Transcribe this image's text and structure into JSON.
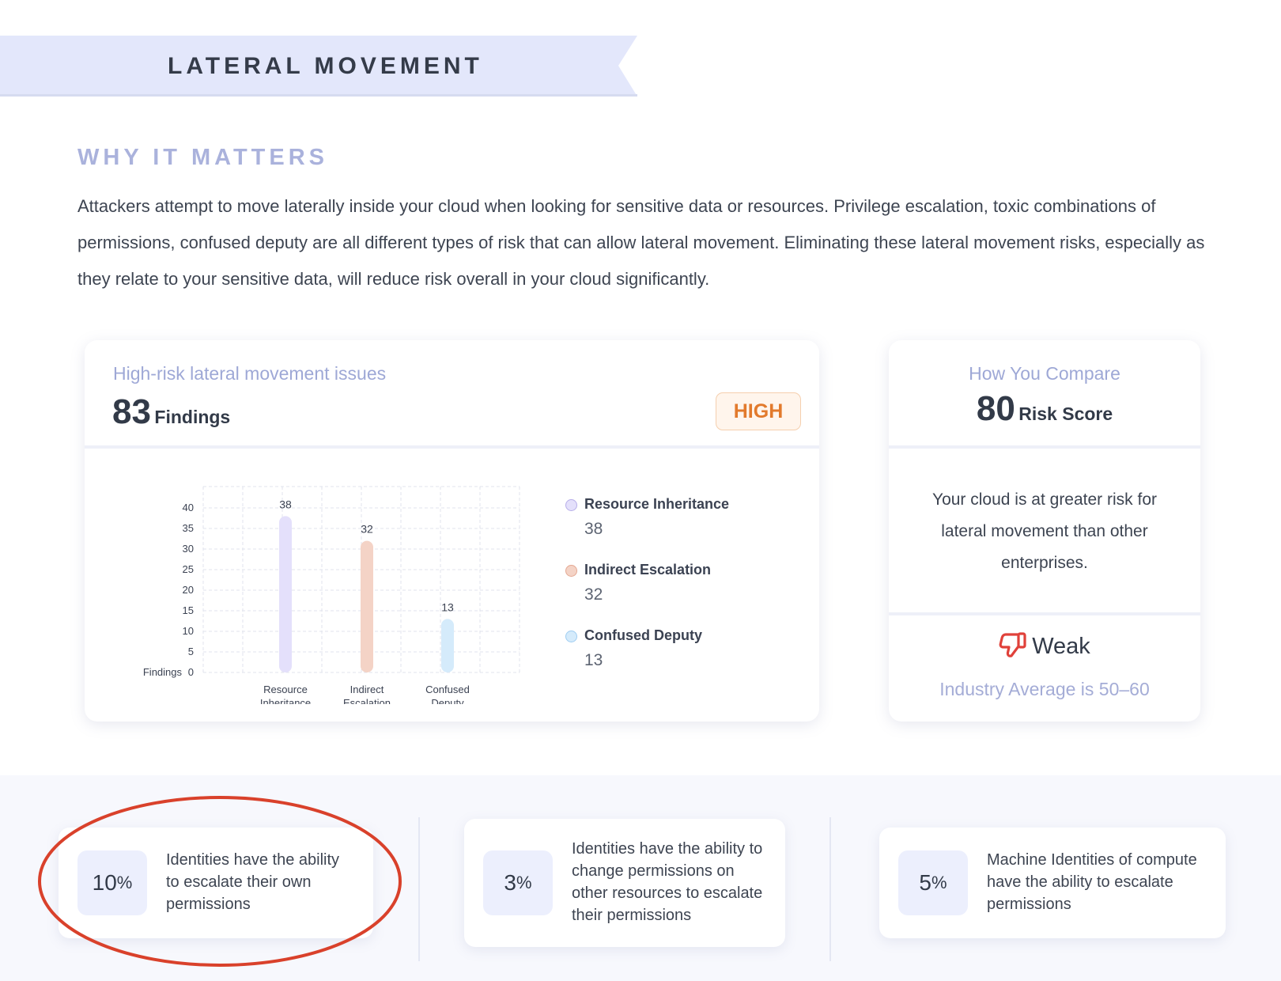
{
  "banner": {
    "title": "LATERAL MOVEMENT"
  },
  "why": {
    "heading": "WHY IT MATTERS",
    "body": "Attackers attempt to move laterally inside your cloud when looking for sensitive data or resources. Privilege escalation, toxic combinations of permissions, confused deputy are all different types of risk that can allow lateral movement. Eliminating these lateral movement risks, especially as they relate to your sensitive data, will reduce risk overall in your cloud significantly."
  },
  "issues_card": {
    "label": "High-risk lateral movement issues",
    "count": "83",
    "count_unit": "Findings",
    "severity": "HIGH",
    "severity_color": "#e27a2c"
  },
  "chart_data": {
    "type": "bar",
    "categories": [
      "Resource Inheritance",
      "Indirect Escalation",
      "Confused Deputy"
    ],
    "category_lines": [
      [
        "Resource",
        "Inheritance"
      ],
      [
        "Indirect",
        "Escalation"
      ],
      [
        "Confused",
        "Deputy"
      ]
    ],
    "values": [
      38,
      32,
      13
    ],
    "colors": [
      "#e4e0fb",
      "#f4d3c6",
      "#d5ebfb"
    ],
    "ylabel": "Findings",
    "ylim": [
      0,
      40
    ],
    "yticks": [
      0,
      5,
      10,
      15,
      20,
      25,
      30,
      35,
      40
    ],
    "grid": true,
    "legend": "right"
  },
  "legend": [
    {
      "name": "Resource Inheritance",
      "value": "38",
      "color": "#e4e0fb",
      "border": "#b7aee9"
    },
    {
      "name": "Indirect Escalation",
      "value": "32",
      "color": "#f4d3c6",
      "border": "#e4a892"
    },
    {
      "name": "Confused Deputy",
      "value": "13",
      "color": "#d5ebfb",
      "border": "#9fcdf1"
    }
  ],
  "compare_card": {
    "label": "How You Compare",
    "score": "80",
    "score_unit": "Risk Score",
    "text": "Your cloud is at greater risk for lateral movement than other enterprises.",
    "rating": "Weak",
    "rating_icon": "thumbs-down-icon",
    "rating_color": "#e0413a",
    "average": "Industry Average is 50–60"
  },
  "stats": [
    {
      "pct": "10",
      "pct_sign": "%",
      "text": "Identities have the ability to escalate their own permissions"
    },
    {
      "pct": "3",
      "pct_sign": "%",
      "text": "Identities have the ability to change permissions on other resources to escalate their permissions"
    },
    {
      "pct": "5",
      "pct_sign": "%",
      "text": "Machine Identities of compute have the ability to escalate permissions"
    }
  ]
}
